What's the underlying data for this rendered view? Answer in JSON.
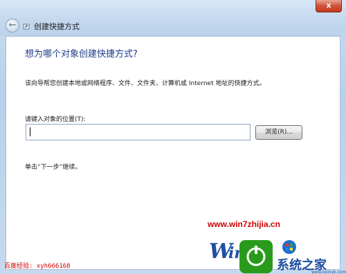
{
  "window": {
    "title": "创建快捷方式",
    "close_label": "x"
  },
  "wizard": {
    "heading": "想为哪个对象创建快捷方式?",
    "description": "该向导帮您创建本地或网络程序、文件、文件夹、计算机或 Internet 地址的快捷方式。",
    "location_label": "请键入对象的位置(T):",
    "location_value": "",
    "browse_label": "浏览(R)...",
    "hint": "单击“下一步”继续。"
  },
  "watermark": {
    "url": "www.win7zhijia.cn",
    "footer_left": "百度经验: xyh666168",
    "logo_text_win": "Win",
    "logo_text_home": "系统之家",
    "logo_sub": "www.kxinyk.com"
  },
  "colors": {
    "heading": "#1e3a8a",
    "watermark_red": "#d10000",
    "window_frame": "#c3d7ee"
  }
}
